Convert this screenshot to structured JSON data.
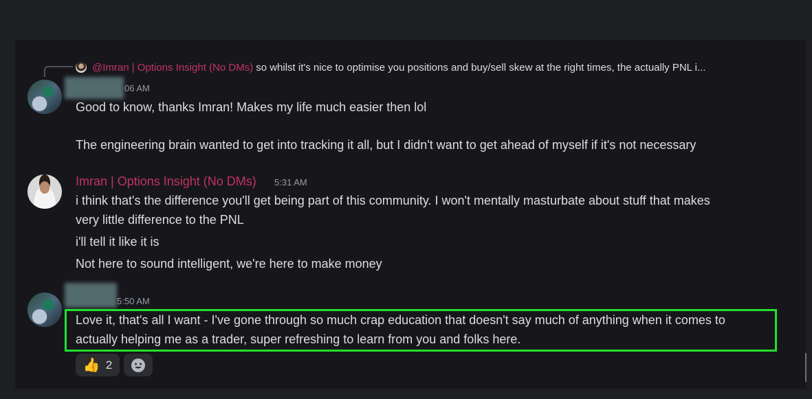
{
  "reply": {
    "mention": "@Imran | Options Insight (No DMs)",
    "text": "so whilst it's nice to optimise you positions and buy/sell skew at the right times, the actually PNL i..."
  },
  "messages": [
    {
      "time": "06 AM",
      "lines": [
        "Good to know, thanks Imran! Makes my life much easier then lol",
        "The engineering brain wanted to get into tracking  it all, but I didn't want to get ahead of myself if it's not necessary"
      ]
    },
    {
      "author": "Imran | Options Insight (No DMs)",
      "author_color": "#c0335f",
      "time": "5:31 AM",
      "lines": [
        "i think that's the difference you'll get being part of this community.  I won't mentally masturbate about stuff that makes",
        "very little difference to the PNL",
        "i'll tell it like it is",
        "Not here to sound intelligent, we're here to make money"
      ]
    },
    {
      "time": "5:50 AM",
      "lines": [
        "Love it, that's all I want - I've gone through so much crap education that doesn't say much of anything when it comes to",
        "actually helping me as a trader, super refreshing to learn from you and folks here."
      ]
    }
  ],
  "reactions": [
    {
      "icon": "thumbs-up-icon",
      "count": "2"
    },
    {
      "icon": "add-reaction-icon"
    }
  ],
  "colors": {
    "highlight": "#22e030",
    "mention": "#c0335f",
    "background": "#17171b"
  }
}
